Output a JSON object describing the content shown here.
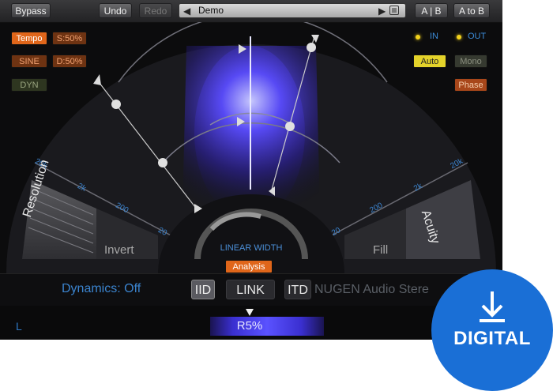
{
  "toolbar": {
    "bypass": "Bypass",
    "undo": "Undo",
    "redo": "Redo",
    "preset_name": "Demo",
    "ab": "A | B",
    "a_to_b": "A to B"
  },
  "left_controls": {
    "tempo": "Tempo",
    "sync_value": "S:50%",
    "sine": "SINE",
    "depth_value": "D:50%",
    "dyn": "DYN"
  },
  "right_controls": {
    "in": "IN",
    "out": "OUT",
    "auto": "Auto",
    "mono": "Mono",
    "phase": "Phase"
  },
  "scope": {
    "left_ticks": [
      "20k",
      "2k",
      "200",
      "20"
    ],
    "right_ticks": [
      "20k",
      "2k",
      "200",
      "20"
    ],
    "resolution": "Resolution",
    "invert": "Invert",
    "fill": "Fill",
    "acuity": "Acuity",
    "linear_width": "LINEAR WIDTH",
    "analysis": "Analysis"
  },
  "strip": {
    "dynamics": "Dynamics: Off",
    "iid": "IID",
    "link": "LINK",
    "itd": "ITD",
    "brand": "NUGEN Audio Stere"
  },
  "meter": {
    "left_label": "L",
    "value": "R5%"
  },
  "badge": {
    "label": "DIGITAL"
  },
  "colors": {
    "accent_orange": "#e0661a",
    "auto_yellow": "#e4d32a",
    "label_blue": "#3b84cf",
    "badge_blue": "#1a6fd6"
  }
}
